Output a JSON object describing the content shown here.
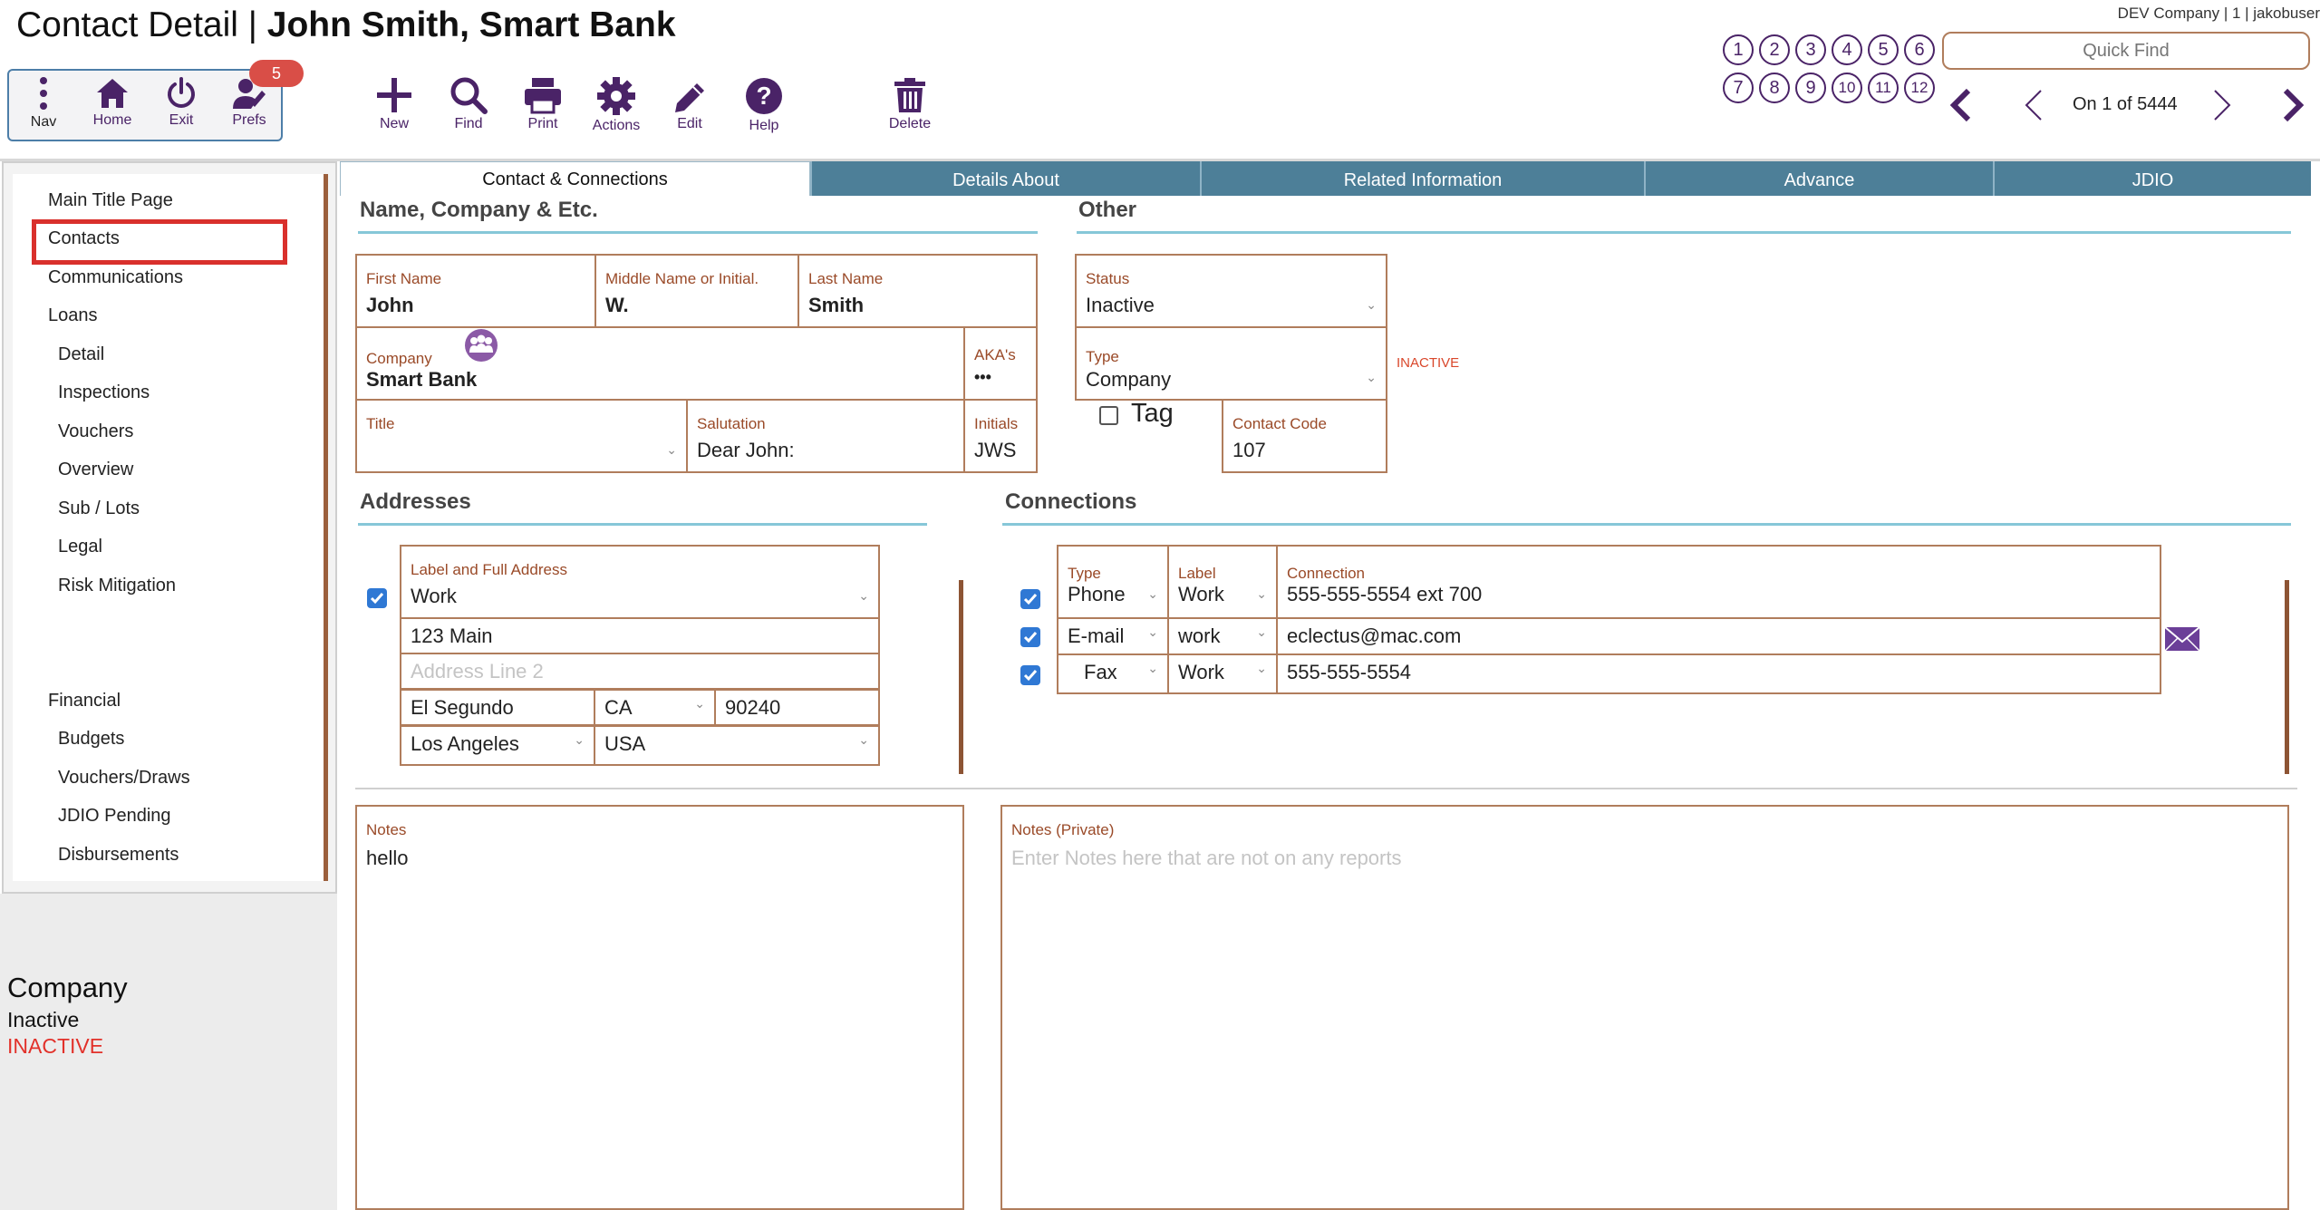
{
  "header": {
    "title_prefix": "Contact Detail | ",
    "title_record": "John Smith, Smart Bank",
    "user_info": "DEV Company | 1 | jakobuser"
  },
  "toolbar": {
    "nav": "Nav",
    "home": "Home",
    "exit": "Exit",
    "prefs": "Prefs",
    "prefs_badge": "5",
    "new": "New",
    "find": "Find",
    "print": "Print",
    "actions": "Actions",
    "edit": "Edit",
    "help": "Help",
    "delete": "Delete"
  },
  "pager": {
    "pages": [
      "1",
      "2",
      "3",
      "4",
      "5",
      "6",
      "7",
      "8",
      "9",
      "10",
      "11",
      "12"
    ],
    "quick_find_placeholder": "Quick Find",
    "record_info": "On 1 of 5444"
  },
  "sidebar": {
    "items": [
      {
        "label": "Main Title Page"
      },
      {
        "label": "Contacts"
      },
      {
        "label": "Communications"
      },
      {
        "label": "Loans"
      },
      {
        "label": "Detail"
      },
      {
        "label": "Inspections"
      },
      {
        "label": "Vouchers"
      },
      {
        "label": "Overview"
      },
      {
        "label": "Sub / Lots"
      },
      {
        "label": "Legal"
      },
      {
        "label": "Risk Mitigation"
      },
      {
        "label": "Financial"
      },
      {
        "label": "Budgets"
      },
      {
        "label": "Vouchers/Draws"
      },
      {
        "label": "JDIO Pending"
      },
      {
        "label": "Disbursements"
      }
    ],
    "selected": "Contacts"
  },
  "left_panel": {
    "type": "Company",
    "status": "Inactive",
    "flag": "INACTIVE"
  },
  "tabs": [
    {
      "label": "Contact & Connections",
      "active": true
    },
    {
      "label": "Details About"
    },
    {
      "label": "Related Information"
    },
    {
      "label": "Advance"
    },
    {
      "label": "JDIO"
    }
  ],
  "sections": {
    "name": "Name, Company & Etc.",
    "other": "Other",
    "addresses": "Addresses",
    "connections": "Connections"
  },
  "name": {
    "first_label": "First Name",
    "first": "John",
    "middle_label": "Middle Name or Initial.",
    "middle": "W.",
    "last_label": "Last Name",
    "last": "Smith",
    "company_label": "Company",
    "company": "Smart Bank",
    "akas_label": "AKA's",
    "akas": "•••",
    "title_label": "Title",
    "title": "",
    "salutation_label": "Salutation",
    "salutation": "Dear John:",
    "initials_label": "Initials",
    "initials": "JWS"
  },
  "other": {
    "status_label": "Status",
    "status": "Inactive",
    "type_label": "Type",
    "type": "Company",
    "inactive_flag": "INACTIVE",
    "tag_label": "Tag",
    "contact_code_label": "Contact Code",
    "contact_code": "107"
  },
  "address": {
    "label": "Label and Full Address",
    "type": "Work",
    "line1": "123 Main",
    "line2_placeholder": "Address Line 2",
    "city": "El Segundo",
    "state": "CA",
    "zip": "90240",
    "county": "Los Angeles",
    "country": "USA"
  },
  "connections": {
    "type_label": "Type",
    "label_label": "Label",
    "connection_label": "Connection",
    "rows": [
      {
        "type": "Phone",
        "label": "Work",
        "value": "555-555-5554 ext 700"
      },
      {
        "type": "E-mail",
        "label": "work",
        "value": "eclectus@mac.com"
      },
      {
        "type": "Fax",
        "label": "Work",
        "value": "555-555-5554"
      }
    ]
  },
  "notes": {
    "label": "Notes",
    "value": "hello",
    "private_label": "Notes (Private)",
    "private_placeholder": "Enter Notes here that are not on any reports"
  },
  "icons": {
    "nav": "kebab-menu-icon",
    "home": "home-icon",
    "exit": "power-icon",
    "prefs": "user-gear-icon",
    "new": "plus-icon",
    "find": "magnifier-icon",
    "print": "printer-icon",
    "actions": "gear-icon",
    "edit": "pencil-icon",
    "help": "question-icon",
    "delete": "trash-icon",
    "company_people": "people-group-icon",
    "email": "envelope-icon"
  },
  "colors": {
    "accent_purple": "#4a2367",
    "border_brown": "#b07d5c",
    "label_rust": "#9a4a28",
    "tab_teal": "#4d7f98",
    "section_rule": "#86c7d8",
    "alert_red": "#e2312a",
    "checkbox_blue": "#2f78d4"
  }
}
